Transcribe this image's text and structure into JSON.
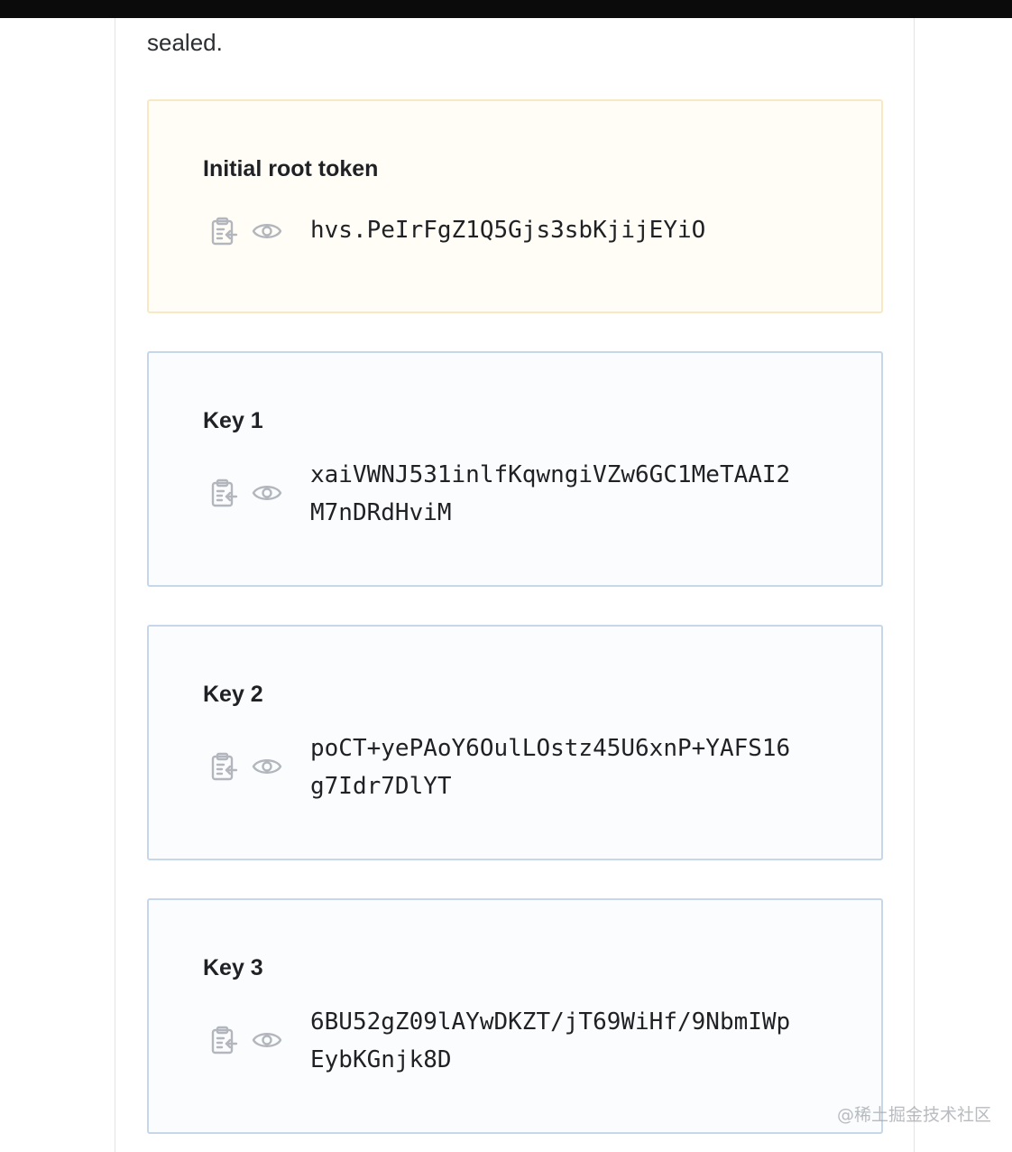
{
  "intro": {
    "text": "sealed."
  },
  "root_token": {
    "title": "Initial root token",
    "value": "hvs.PeIrFgZ1Q5Gjs3sbKjijEYiO"
  },
  "keys": [
    {
      "title": "Key 1",
      "value": "xaiVWNJ531inlfKqwngiVZw6GC1MeTAAI2M7nDRdHviM"
    },
    {
      "title": "Key 2",
      "value": "poCT+yePAoY6OulLOstz45U6xnP+YAFS16g7Idr7DlYT"
    },
    {
      "title": "Key 3",
      "value": "6BU52gZ09lAYwDKZT/jT69WiHf/9NbmIWpEybKGnjk8D"
    }
  ],
  "icons": {
    "copy": "clipboard-copy-icon",
    "reveal": "eye-icon"
  },
  "colors": {
    "root_card_bg": "#fffdf6",
    "root_card_border": "#f6e9c4",
    "key_card_bg": "#fafcfe",
    "key_card_border": "#c6d7ea",
    "icon_color": "#b3b7bd"
  },
  "watermark": {
    "text": "@稀土掘金技术社区"
  }
}
